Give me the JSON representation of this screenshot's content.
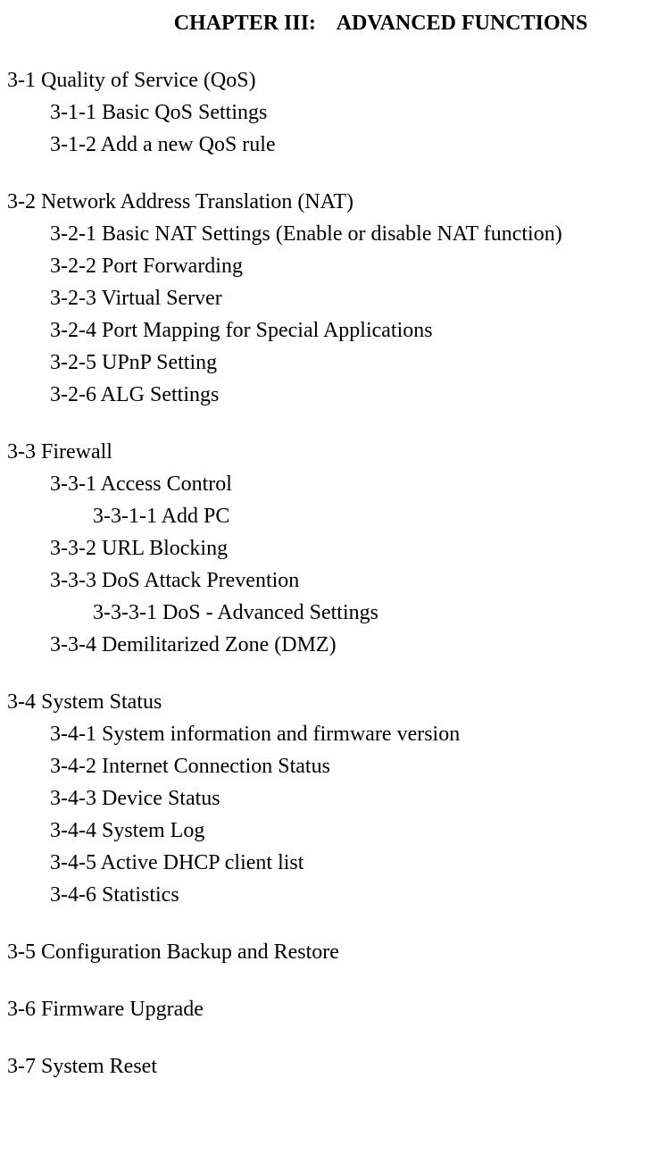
{
  "chapter_title": "CHAPTER III:    ADVANCED FUNCTIONS",
  "sections": [
    {
      "title": "3-1 Quality of Service (QoS)",
      "children": [
        {
          "level": 1,
          "text": "3-1-1 Basic QoS Settings"
        },
        {
          "level": 1,
          "text": "3-1-2 Add a new QoS rule"
        }
      ]
    },
    {
      "title": "3-2 Network Address Translation (NAT)",
      "children": [
        {
          "level": 1,
          "text": "3-2-1 Basic NAT Settings (Enable or disable NAT function)"
        },
        {
          "level": 1,
          "text": "3-2-2 Port Forwarding"
        },
        {
          "level": 1,
          "text": "3-2-3 Virtual Server"
        },
        {
          "level": 1,
          "text": "3-2-4 Port Mapping for Special Applications"
        },
        {
          "level": 1,
          "text": "3-2-5 UPnP Setting"
        },
        {
          "level": 1,
          "text": "3-2-6 ALG Settings"
        }
      ]
    },
    {
      "title": "3-3 Firewall",
      "children": [
        {
          "level": 1,
          "text": "3-3-1 Access Control"
        },
        {
          "level": 2,
          "text": "3-3-1-1 Add PC"
        },
        {
          "level": 1,
          "text": "3-3-2 URL Blocking"
        },
        {
          "level": 1,
          "text": "3-3-3 DoS Attack Prevention"
        },
        {
          "level": 2,
          "text": "3-3-3-1 DoS - Advanced Settings"
        },
        {
          "level": 1,
          "text": "3-3-4 Demilitarized Zone (DMZ)"
        }
      ]
    },
    {
      "title": "3-4 System Status",
      "children": [
        {
          "level": 1,
          "text": "3-4-1 System information and firmware version"
        },
        {
          "level": 1,
          "text": "3-4-2 Internet Connection Status"
        },
        {
          "level": 1,
          "text": "3-4-3 Device Status"
        },
        {
          "level": 1,
          "text": "3-4-4 System Log"
        },
        {
          "level": 1,
          "text": "3-4-5 Active DHCP client list"
        },
        {
          "level": 1,
          "text": "3-4-6 Statistics"
        }
      ]
    },
    {
      "title": "3-5 Configuration Backup and Restore",
      "children": []
    },
    {
      "title": "3-6 Firmware Upgrade",
      "children": []
    },
    {
      "title": "3-7 System Reset",
      "children": []
    }
  ]
}
